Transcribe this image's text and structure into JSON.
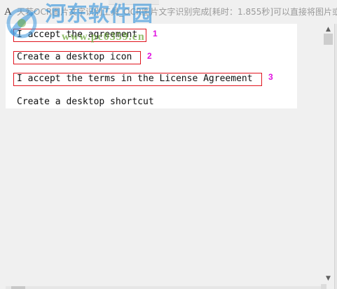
{
  "window": {
    "app_icon": "A",
    "title": "天若OCR图片文字识别工具_OCR图片文字识别完成[耗时：1.855秒]可以直接将图片或"
  },
  "watermark": {
    "logo_icon": "hedong-logo-icon",
    "site_name": "河东软件园",
    "url": "www.pc0359.cn"
  },
  "ocr": {
    "lines": [
      {
        "text": "I accept the agreement",
        "marker": "1"
      },
      {
        "text": "Create a desktop icon",
        "marker": "2"
      },
      {
        "text": "I accept the terms in the License Agreement",
        "marker": "3"
      },
      {
        "text": "Create a desktop shortcut",
        "marker": ""
      }
    ]
  },
  "scrollbar": {
    "up_icon": "arrow-up-icon",
    "down_icon": "arrow-down-icon"
  },
  "colors": {
    "highlight_box": "#e0141e",
    "marker": "#e010e0",
    "watermark_text": "#3a96dc",
    "watermark_url": "#6eaa3c"
  }
}
